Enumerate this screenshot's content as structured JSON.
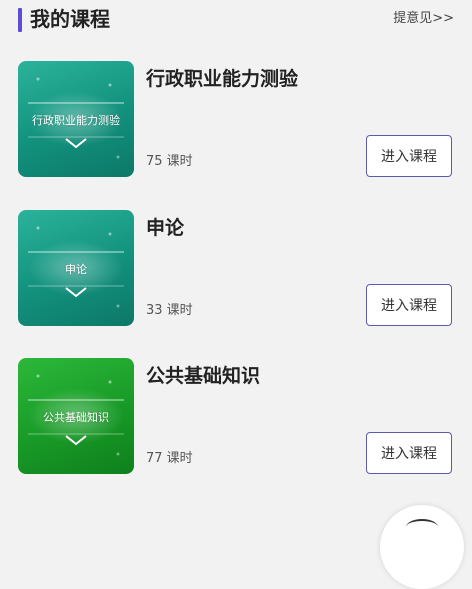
{
  "header": {
    "title": "我的课程",
    "feedback_link": "提意见>>"
  },
  "courses": [
    {
      "thumbnail_text": "行政职业能力测验",
      "title": "行政职业能力测验",
      "hours": "75 课时",
      "button": "进入课程",
      "thumbnail_color": "#16967f"
    },
    {
      "thumbnail_text": "申论",
      "title": "申论",
      "hours": "33 课时",
      "button": "进入课程",
      "thumbnail_color": "#16967f"
    },
    {
      "thumbnail_text": "公共基础知识",
      "title": "公共基础知识",
      "hours": "77 课时",
      "button": "进入课程",
      "thumbnail_color": "#1a9c28"
    }
  ],
  "accent_color": "#5b4fd6"
}
